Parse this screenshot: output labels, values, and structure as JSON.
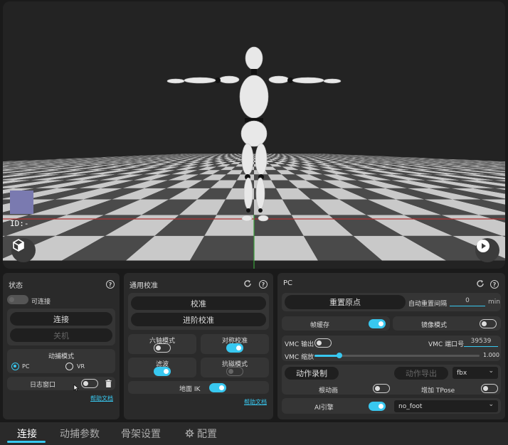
{
  "viewport": {
    "id_label": "ID:-",
    "cube_icon": "cube-icon",
    "play_icon": "play-icon"
  },
  "status_panel": {
    "title": "状态",
    "connectable_label": "可连接",
    "connect_label": "连接",
    "shutdown_label": "关机",
    "mocap_mode_title": "动捕模式",
    "modes": [
      "PC",
      "VR"
    ],
    "selected_mode": "PC",
    "log_window_label": "日志窗口",
    "help_doc": "帮助文档"
  },
  "calibration_panel": {
    "title": "通用校准",
    "calibrate_label": "校准",
    "advanced_calibrate_label": "进阶校准",
    "six_axis_label": "六轴模式",
    "symmetric_label": "对称校准",
    "filter_label": "滤波",
    "anti_magnetic_label": "抗磁模式",
    "ground_ik_label": "地面 IK",
    "help_doc": "帮助文档"
  },
  "pc_panel": {
    "title": "PC",
    "reset_origin_label": "重置原点",
    "auto_reset_label": "自动重置间隔",
    "auto_reset_value": "0",
    "auto_reset_unit": "min",
    "frame_cache_label": "帧缓存",
    "mirror_mode_label": "镜像模式",
    "vmc_output_label": "VMC 输出",
    "vmc_port_label": "VMC 端口号",
    "vmc_port_value": "39539",
    "vmc_scale_label": "VMC 缩放",
    "vmc_scale_value": "1.000",
    "vmc_scale_fraction": 0.15,
    "record_label": "动作录制",
    "export_label": "动作导出",
    "export_format": "fbx",
    "root_motion_label": "根动画",
    "add_tpose_label": "增加 TPose",
    "ai_engine_label": "AI引擎",
    "ai_engine_value": "no_foot"
  },
  "toggles": {
    "connectable": false,
    "log_window": false,
    "six_axis": false,
    "symmetric": true,
    "filter": true,
    "anti_magnetic": false,
    "ground_ik": true,
    "frame_cache": true,
    "mirror_mode": false,
    "vmc_output": false,
    "root_motion": false,
    "add_tpose": false,
    "ai_engine": true
  },
  "tabs": [
    "连接",
    "动捕参数",
    "骨架设置",
    "配置"
  ],
  "active_tab": "连接",
  "colors": {
    "accent": "#38c8f0",
    "panel": "#2a2a2a",
    "background": "#1a1a1a"
  }
}
